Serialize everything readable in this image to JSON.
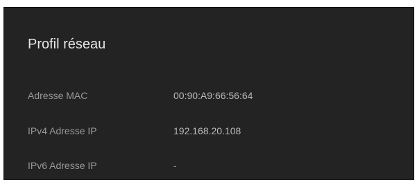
{
  "network_profile": {
    "title": "Profil réseau",
    "rows": [
      {
        "label": "Adresse MAC",
        "value": "00:90:A9:66:56:64"
      },
      {
        "label": "IPv4 Adresse IP",
        "value": "192.168.20.108"
      },
      {
        "label": "IPv6 Adresse IP",
        "value": "-"
      }
    ]
  }
}
